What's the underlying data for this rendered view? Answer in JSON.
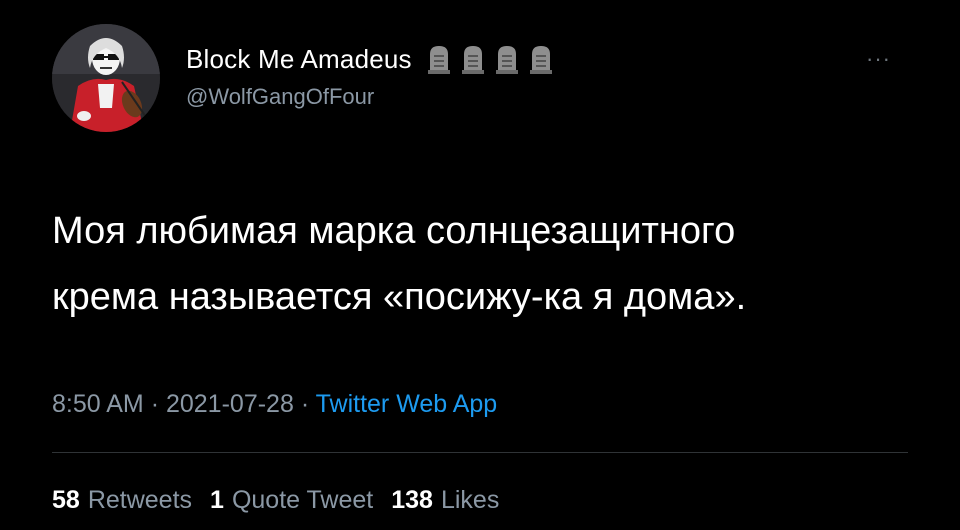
{
  "user": {
    "display_name": "Block Me Amadeus",
    "handle": "@WolfGangOfFour",
    "avatar_icon": "skeleton-mozart-avatar",
    "name_emojis": [
      "headstone-icon",
      "headstone-icon",
      "headstone-icon",
      "headstone-icon"
    ]
  },
  "menu": {
    "more_label": "···"
  },
  "tweet": {
    "text_lines": [
      "Моя любимая марка солнцезащитного",
      "крема называется «посижу-ка я дома»."
    ]
  },
  "meta": {
    "time": "8:50 AM",
    "separator": "·",
    "date": "2021-07-28",
    "source": "Twitter Web App"
  },
  "stats": {
    "retweets_count": "58",
    "retweets_label": "Retweets",
    "quotes_count": "1",
    "quotes_label": "Quote Tweet",
    "likes_count": "138",
    "likes_label": "Likes"
  },
  "colors": {
    "background": "#000000",
    "text": "#ffffff",
    "secondary": "#8b98a5",
    "link": "#1d9bf0",
    "divider": "#2f3336"
  }
}
